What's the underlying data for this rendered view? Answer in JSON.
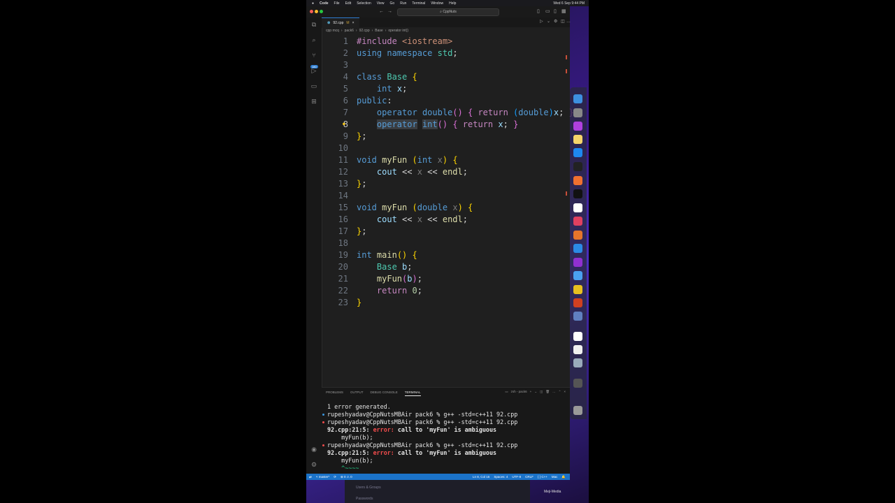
{
  "menubar": {
    "apple": "",
    "items": [
      "Code",
      "File",
      "Edit",
      "Selection",
      "View",
      "Go",
      "Run",
      "Terminal",
      "Window",
      "Help"
    ],
    "datetime": "Wed 6 Sep 9:44 PM"
  },
  "titlebar": {
    "search": "CppNuts"
  },
  "activity": {
    "badge": "180"
  },
  "tab": {
    "filename": "92.cpp",
    "modified": "M"
  },
  "breadcrumbs": [
    "cpp mcq",
    "pack6",
    "92.cpp",
    "Base",
    "operator int()"
  ],
  "editor": {
    "current_line": 8,
    "line_numbers": [
      "1",
      "2",
      "3",
      "4",
      "5",
      "6",
      "7",
      "8",
      "9",
      "10",
      "11",
      "12",
      "13",
      "14",
      "15",
      "16",
      "17",
      "18",
      "19",
      "20",
      "21",
      "22",
      "23"
    ]
  },
  "code_lines": [
    "#include <iostream>",
    "using namespace std;",
    "",
    "class Base {",
    "    int x;",
    "public:",
    "    operator double() { return (double)x; }",
    "    operator int() { return x; }",
    "};",
    "",
    "void myFun (int x) {",
    "    cout << x << endl;",
    "};",
    "",
    "void myFun (double x) {",
    "    cout << x << endl;",
    "};",
    "",
    "int main() {",
    "    Base b;",
    "    myFun(b);",
    "    return 0;",
    "}"
  ],
  "panel": {
    "tabs": [
      "PROBLEMS",
      "OUTPUT",
      "DEBUG CONSOLE",
      "TERMINAL"
    ],
    "active_tab": "TERMINAL",
    "shell": "zsh - pack6"
  },
  "terminal": {
    "l1": "1 error generated.",
    "prompt": "rupeshyadav@CppNutsMBAir pack6 % g++ -std=c++11 92.cpp",
    "err_loc": "92.cpp:21:5:",
    "err_word": "error:",
    "err_msg": "call to 'myFun' is ambiguous",
    "src": "    myFun(b);",
    "tilde": "    ^~~~~"
  },
  "statusbar": {
    "branch": "master*",
    "problems": "⊗ 0 ⚠ 0",
    "position": "Ln 8, Col 16",
    "spaces": "Spaces: 4",
    "encoding": "UTF-8",
    "eol": "CRLF",
    "language": "C++",
    "platform": "Mac"
  },
  "bottom_hint": {
    "item1": "Users & Groups",
    "item2": "Passwords",
    "brand": "Meji-Media"
  },
  "colors": {
    "accent": "#1b73c9",
    "error": "#f14c4c"
  }
}
